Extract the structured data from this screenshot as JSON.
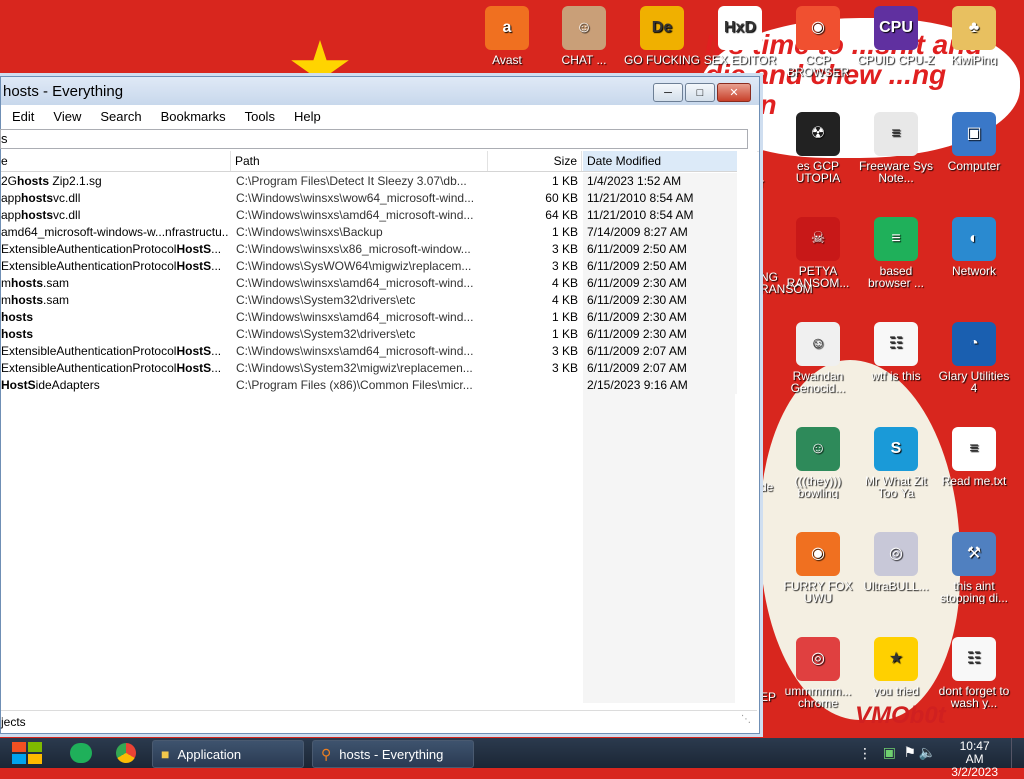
{
  "desktop": {
    "meme_text": "It's time to ...shit and die and chew ...ng ...illin",
    "meme_bottom": "VMOb0t",
    "icons": [
      {
        "label": "Avast",
        "color": "#f07020",
        "glyph": "a"
      },
      {
        "label": "CHAT ...",
        "color": "#c99f78",
        "glyph": "☺"
      },
      {
        "label": "GO FUCKING",
        "color": "#f0b000",
        "glyph": "De"
      },
      {
        "label": "SEX EDITOR",
        "color": "#ffffff",
        "glyph": "HxD"
      },
      {
        "label": "CCP BROWSER",
        "color": "#f05030",
        "glyph": "◉"
      },
      {
        "label": "CPUID CPU-Z",
        "color": "#6030a0",
        "glyph": "CPU"
      },
      {
        "label": "KiwiPing",
        "color": "#e8c060",
        "glyph": "♣"
      },
      {
        "label": "es GCP UTOPIA",
        "color": "#222222",
        "glyph": "☢"
      },
      {
        "label": "Freeware Sys Note...",
        "color": "#e8e8e8",
        "glyph": "≡"
      },
      {
        "label": "Computer",
        "color": "#3a78c8",
        "glyph": "▣"
      },
      {
        "label": "PETYA RANSOM...",
        "color": "#c81818",
        "glyph": "☠"
      },
      {
        "label": "based browser ...",
        "color": "#1fb05a",
        "glyph": "≡"
      },
      {
        "label": "Network",
        "color": "#2a8ad0",
        "glyph": "◐"
      },
      {
        "label": "Rwandan Genocid...",
        "color": "#f0f0f0",
        "glyph": "☺"
      },
      {
        "label": "wtf is this",
        "color": "#f8f8f8",
        "glyph": "☷"
      },
      {
        "label": "Glary Utilities 4",
        "color": "#1a5fb0",
        "glyph": "◔"
      },
      {
        "label": "(((they))) bowling",
        "color": "#2e8a5a",
        "glyph": "☺"
      },
      {
        "label": "Mr What Zit Too Ya",
        "color": "#1a9ad8",
        "glyph": "S"
      },
      {
        "label": "Read me.txt",
        "color": "#ffffff",
        "glyph": "≡"
      },
      {
        "label": "FURRY FOX UWU",
        "color": "#f07020",
        "glyph": "◉"
      },
      {
        "label": "UltraBULL...",
        "color": "#c8c8d8",
        "glyph": "◎"
      },
      {
        "label": "this aint stopping di...",
        "color": "#5080c0",
        "glyph": "⚒"
      },
      {
        "label": "ummmmm... chrome",
        "color": "#e04040",
        "glyph": "◎"
      },
      {
        "label": "you tried",
        "color": "#ffd000",
        "glyph": "★"
      },
      {
        "label": "dont forget to wash y...",
        "color": "#f8f8f8",
        "glyph": "☷"
      }
    ],
    "partial_labels": [
      "r",
      "NG",
      "RANSOM",
      "de",
      "EP"
    ]
  },
  "window": {
    "title": "hosts - Everything",
    "menus": [
      "Edit",
      "View",
      "Search",
      "Bookmarks",
      "Tools",
      "Help"
    ],
    "search_value": "s",
    "columns": {
      "name": "e",
      "path": "Path",
      "size": "Size",
      "date": "Date Modified"
    },
    "rows": [
      {
        "name_pre": "2G",
        "name_hl": "hosts",
        "name_post": " Zip2.1.sg",
        "path": "C:\\Program Files\\Detect It Sleezy 3.07\\db...",
        "size": "1 KB",
        "date": "1/4/2023 1:52 AM"
      },
      {
        "name_pre": "app",
        "name_hl": "hosts",
        "name_post": "vc.dll",
        "path": "C:\\Windows\\winsxs\\wow64_microsoft-wind...",
        "size": "60 KB",
        "date": "11/21/2010 8:54 AM"
      },
      {
        "name_pre": "app",
        "name_hl": "hosts",
        "name_post": "vc.dll",
        "path": "C:\\Windows\\winsxs\\amd64_microsoft-wind...",
        "size": "64 KB",
        "date": "11/21/2010 8:54 AM"
      },
      {
        "name_pre": "amd64_microsoft-windows-w...nfrastructu...",
        "name_hl": "",
        "name_post": "",
        "path": "C:\\Windows\\winsxs\\Backup",
        "size": "1 KB",
        "date": "7/14/2009 8:27 AM"
      },
      {
        "name_pre": "ExtensibleAuthenticationProtocol",
        "name_hl": "HostS",
        "name_post": "...",
        "path": "C:\\Windows\\winsxs\\x86_microsoft-window...",
        "size": "3 KB",
        "date": "6/11/2009 2:50 AM"
      },
      {
        "name_pre": "ExtensibleAuthenticationProtocol",
        "name_hl": "HostS",
        "name_post": "...",
        "path": "C:\\Windows\\SysWOW64\\migwiz\\replacem...",
        "size": "3 KB",
        "date": "6/11/2009 2:50 AM"
      },
      {
        "name_pre": "m",
        "name_hl": "hosts",
        "name_post": ".sam",
        "path": "C:\\Windows\\winsxs\\amd64_microsoft-wind...",
        "size": "4 KB",
        "date": "6/11/2009 2:30 AM"
      },
      {
        "name_pre": "m",
        "name_hl": "hosts",
        "name_post": ".sam",
        "path": "C:\\Windows\\System32\\drivers\\etc",
        "size": "4 KB",
        "date": "6/11/2009 2:30 AM"
      },
      {
        "name_pre": "",
        "name_hl": "hosts",
        "name_post": "",
        "path": "C:\\Windows\\winsxs\\amd64_microsoft-wind...",
        "size": "1 KB",
        "date": "6/11/2009 2:30 AM"
      },
      {
        "name_pre": "",
        "name_hl": "hosts",
        "name_post": "",
        "path": "C:\\Windows\\System32\\drivers\\etc",
        "size": "1 KB",
        "date": "6/11/2009 2:30 AM"
      },
      {
        "name_pre": "ExtensibleAuthenticationProtocol",
        "name_hl": "HostS",
        "name_post": "...",
        "path": "C:\\Windows\\winsxs\\amd64_microsoft-wind...",
        "size": "3 KB",
        "date": "6/11/2009 2:07 AM"
      },
      {
        "name_pre": "ExtensibleAuthenticationProtocol",
        "name_hl": "HostS",
        "name_post": "...",
        "path": "C:\\Windows\\System32\\migwiz\\replacemen...",
        "size": "3 KB",
        "date": "6/11/2009 2:07 AM"
      },
      {
        "name_pre": "",
        "name_hl": "HostS",
        "name_post": "ideAdapters",
        "path": "C:\\Program Files (x86)\\Common Files\\micr...",
        "size": "",
        "date": "2/15/2023 9:16 AM"
      }
    ],
    "status": "jects"
  },
  "taskbar": {
    "items": [
      {
        "label": "Application",
        "icon": "folder-icon"
      },
      {
        "label": "hosts - Everything",
        "icon": "search-icon"
      }
    ],
    "time": "10:47 AM",
    "date": "3/2/2023"
  }
}
